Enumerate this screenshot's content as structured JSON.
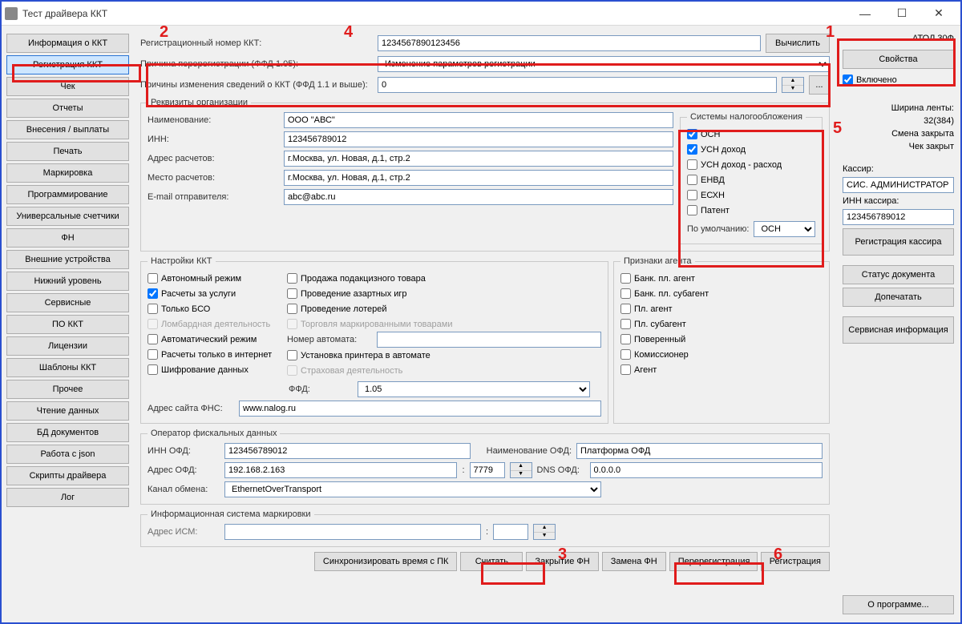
{
  "window": {
    "title": "Тест драйвера ККТ"
  },
  "nav": {
    "items": [
      "Информация о ККТ",
      "Регистрация ККТ",
      "Чек",
      "Отчеты",
      "Внесения / выплаты",
      "Печать",
      "Маркировка",
      "Программирование",
      "Универсальные счетчики",
      "ФН",
      "Внешние устройства",
      "Нижний уровень",
      "Сервисные",
      "ПО ККТ",
      "Лицензии",
      "Шаблоны ККТ",
      "Прочее",
      "Чтение данных",
      "БД документов",
      "Работа с json",
      "Скрипты драйвера",
      "Лог"
    ],
    "active_index": 1
  },
  "reg": {
    "lbl_regnum": "Регистрационный номер ККТ:",
    "regnum": "1234567890123456",
    "btn_calc": "Вычислить",
    "lbl_reason": "Причина перерегистрации (ФФД 1.05):",
    "reason": "Изменение параметров регистрации",
    "lbl_reason11": "Причины изменения сведений о ККТ (ФФД 1.1 и выше):",
    "reason11": "0",
    "btn_more": "..."
  },
  "org": {
    "legend": "Реквизиты организации",
    "lbl_name": "Наименование:",
    "name": "ООО \"АВС\"",
    "lbl_inn": "ИНН:",
    "inn": "123456789012",
    "lbl_addr": "Адрес расчетов:",
    "addr": "г.Москва, ул. Новая, д.1, стр.2",
    "lbl_place": "Место расчетов:",
    "place": "г.Москва, ул. Новая, д.1, стр.2",
    "lbl_email": "E-mail отправителя:",
    "email": "abc@abc.ru",
    "tax_legend": "Системы налогообложения",
    "tax": [
      {
        "label": "ОСН",
        "checked": true
      },
      {
        "label": "УСН доход",
        "checked": true
      },
      {
        "label": "УСН доход - расход",
        "checked": false
      },
      {
        "label": "ЕНВД",
        "checked": false
      },
      {
        "label": "ЕСХН",
        "checked": false
      },
      {
        "label": "Патент",
        "checked": false
      }
    ],
    "lbl_default": "По умолчанию:",
    "default_tax": "ОСН"
  },
  "kkt": {
    "legend": "Настройки ККТ",
    "col1": [
      {
        "label": "Автономный режим",
        "checked": false,
        "disabled": false
      },
      {
        "label": "Расчеты за услуги",
        "checked": true,
        "disabled": false
      },
      {
        "label": "Только БСО",
        "checked": false,
        "disabled": false
      },
      {
        "label": "Ломбардная деятельность",
        "checked": false,
        "disabled": true
      },
      {
        "label": "Автоматический режим",
        "checked": false,
        "disabled": false
      },
      {
        "label": "Расчеты только в интернет",
        "checked": false,
        "disabled": false
      },
      {
        "label": "Шифрование данных",
        "checked": false,
        "disabled": false
      }
    ],
    "col2": [
      {
        "label": "Продажа подакцизного товара",
        "checked": false,
        "disabled": false
      },
      {
        "label": "Проведение азартных игр",
        "checked": false,
        "disabled": false
      },
      {
        "label": "Проведение лотерей",
        "checked": false,
        "disabled": false
      },
      {
        "label": "Торговля маркированными товарами",
        "checked": false,
        "disabled": true
      },
      {
        "label": "Номер автомата:",
        "checked": null,
        "disabled": false
      },
      {
        "label": "Установка принтера в автомате",
        "checked": false,
        "disabled": false
      },
      {
        "label": "Страховая деятельность",
        "checked": false,
        "disabled": true
      }
    ],
    "lbl_ffd": "ФФД:",
    "ffd": "1.05",
    "lbl_fns": "Адрес сайта ФНС:",
    "fns": "www.nalog.ru"
  },
  "agent": {
    "legend": "Признаки агента",
    "items": [
      {
        "label": "Банк. пл. агент",
        "checked": false
      },
      {
        "label": "Банк. пл. субагент",
        "checked": false
      },
      {
        "label": "Пл. агент",
        "checked": false
      },
      {
        "label": "Пл. субагент",
        "checked": false
      },
      {
        "label": "Поверенный",
        "checked": false
      },
      {
        "label": "Комиссионер",
        "checked": false
      },
      {
        "label": "Агент",
        "checked": false
      }
    ]
  },
  "ofd": {
    "legend": "Оператор фискальных данных",
    "lbl_inn": "ИНН ОФД:",
    "inn": "123456789012",
    "lbl_name": "Наименование ОФД:",
    "name": "Платформа ОФД",
    "lbl_addr": "Адрес ОФД:",
    "addr": "192.168.2.163",
    "port": "7779",
    "lbl_dns": "DNS ОФД:",
    "dns": "0.0.0.0",
    "lbl_channel": "Канал обмена:",
    "channel": "EthernetOverTransport"
  },
  "ism": {
    "legend": "Информационная система маркировки",
    "lbl_addr": "Адрес ИСМ:",
    "addr": "",
    "port_sep": ":"
  },
  "footer": {
    "sync": "Синхронизировать время с ПК",
    "read": "Считать",
    "close_fn": "Закрытие ФН",
    "change_fn": "Замена ФН",
    "rereg": "Перерегистрация",
    "reg": "Регистрация"
  },
  "right": {
    "device": "АТОЛ 30Ф",
    "btn_props": "Свойства",
    "enabled_lbl": "Включено",
    "enabled": true,
    "width_lbl": "Ширина ленты:",
    "width_val": "32(384)",
    "shift": "Смена закрыта",
    "check": "Чек закрыт",
    "cashier_lbl": "Кассир:",
    "cashier": "СИС. АДМИНИСТРАТОР",
    "cashier_inn_lbl": "ИНН кассира:",
    "cashier_inn": "123456789012",
    "btn_reg_cashier": "Регистрация кассира",
    "btn_doc_status": "Статус документа",
    "btn_reprint": "Допечатать",
    "btn_service": "Сервисная информация",
    "btn_about": "О программе..."
  },
  "annotations": {
    "n1": "1",
    "n2": "2",
    "n3": "3",
    "n4": "4",
    "n5": "5",
    "n6": "6"
  }
}
